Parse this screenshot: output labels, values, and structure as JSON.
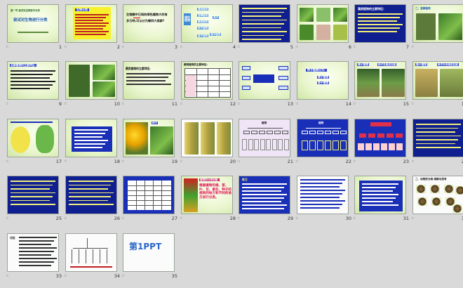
{
  "slides": [
    {
      "num": "1",
      "title": "尝试对生物进行分类",
      "sub": "第一节  尝试对生物进行分类",
      "kind": "cover"
    },
    {
      "num": "2",
      "title": "生物分类",
      "kind": "yellow"
    },
    {
      "num": "3",
      "title": "生物圈中已知的绿色植物大约有",
      "text": "多万种,可以分为哪四大类群?",
      "kind": "question"
    },
    {
      "num": "4",
      "title": "绿色植物",
      "items": [
        "藻类植物",
        "苔藓植物",
        "蕨类植物",
        "种子植物",
        "孢子",
        "裸子植物",
        "被子植物"
      ],
      "kind": "tree"
    },
    {
      "num": "5",
      "kind": "navylist"
    },
    {
      "num": "6",
      "kind": "photos"
    },
    {
      "num": "7",
      "title": "藻类植物的主要特征:",
      "kind": "navytext"
    },
    {
      "num": "8",
      "title": "二、苔藓植物",
      "kind": "moss"
    },
    {
      "num": "9",
      "title": "苔藓植物的主要特征:",
      "kind": "bluetext"
    },
    {
      "num": "10",
      "kind": "photoboth"
    },
    {
      "num": "11",
      "title": "蕨类植物的主要特征:",
      "kind": "lavtext"
    },
    {
      "num": "12",
      "title": "蕨类植物的主要特征:",
      "kind": "table"
    },
    {
      "num": "13",
      "kind": "mindmap"
    },
    {
      "num": "14",
      "title": "种子植物分为:",
      "items": [
        "裸子植物",
        "被子植物"
      ],
      "kind": "seedsplit"
    },
    {
      "num": "15",
      "title": "裸子植物",
      "label": "种子无果皮包被",
      "kind": "gymno"
    },
    {
      "num": "16",
      "title": "被子植物",
      "label": "种子外有果皮包被",
      "kind": "angio"
    },
    {
      "num": "17",
      "kind": "bean"
    },
    {
      "num": "18",
      "kind": "bluetable"
    },
    {
      "num": "19",
      "label": "种子",
      "kind": "sunflower"
    },
    {
      "num": "20",
      "kind": "corn"
    },
    {
      "num": "21",
      "title": "植物",
      "kind": "lavtree"
    },
    {
      "num": "22",
      "title": "植物",
      "kind": "bluetree"
    },
    {
      "num": "23",
      "kind": "bluetree2"
    },
    {
      "num": "24",
      "kind": "navytext2"
    },
    {
      "num": "25",
      "kind": "navytext3"
    },
    {
      "num": "26",
      "kind": "navytext4"
    },
    {
      "num": "27",
      "kind": "bluetable2"
    },
    {
      "num": "28",
      "title": "植物的分类依据:",
      "text": "根据植物的根、茎、叶、花、果实、种子的相同的地方和不同的地方进行分类。",
      "kind": "classify"
    },
    {
      "num": "29",
      "title": "练习",
      "kind": "practice"
    },
    {
      "num": "30",
      "kind": "whitelist"
    },
    {
      "num": "31",
      "kind": "bluebox"
    },
    {
      "num": "32",
      "title": "二、动物的分类:观察与思考",
      "kind": "animals"
    },
    {
      "num": "33",
      "title": "讨论",
      "kind": "discussion"
    },
    {
      "num": "34",
      "kind": "chart"
    },
    {
      "num": "35",
      "title": "第1PPT",
      "kind": "logo"
    }
  ],
  "colors": {
    "selected": "#f0a030",
    "blue": "#1a2fb8",
    "navy": "#0f1f8f"
  }
}
